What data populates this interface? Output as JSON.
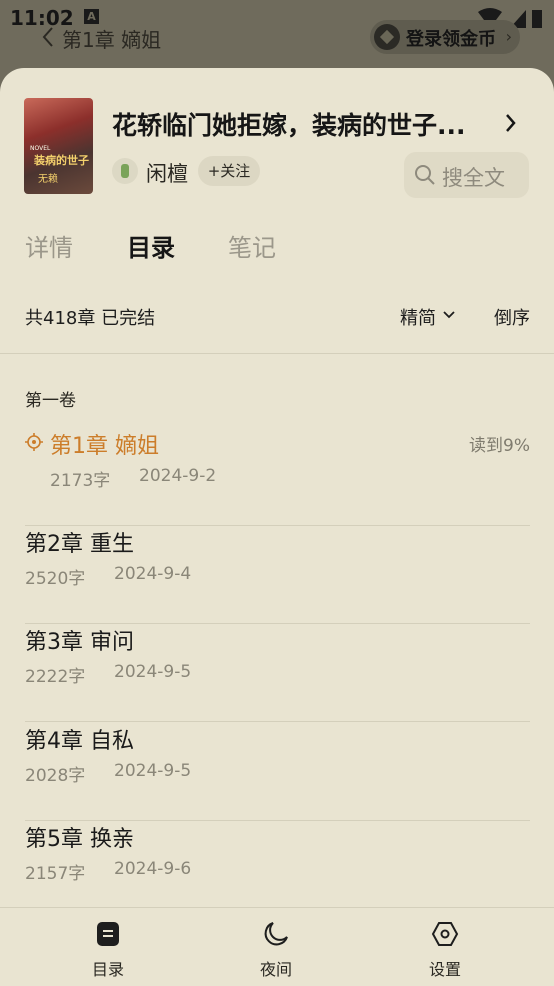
{
  "status_bar": {
    "time": "11:02",
    "indicator": "A"
  },
  "reader_bar": {
    "chapter_title": "第1章 嫡姐",
    "coin_label": "登录领金币"
  },
  "book": {
    "title": "花轿临门她拒嫁，装病的世子...",
    "author": "闲檀",
    "follow_label": "+关注",
    "search_label": "搜全文",
    "cover_text": [
      "装病的世子",
      "无赖"
    ]
  },
  "tabs": [
    {
      "label": "详情"
    },
    {
      "label": "目录"
    },
    {
      "label": "笔记"
    }
  ],
  "catalog": {
    "summary": "共418章 已完结",
    "charset_toggle": "精简",
    "sort_label": "倒序",
    "volume": "第一卷"
  },
  "chapters": [
    {
      "name": "第1章 嫡姐",
      "words": "2173字",
      "date": "2024-9-2",
      "progress": "读到9%"
    },
    {
      "name": "第2章 重生",
      "words": "2520字",
      "date": "2024-9-4"
    },
    {
      "name": "第3章 审问",
      "words": "2222字",
      "date": "2024-9-5"
    },
    {
      "name": "第4章 自私",
      "words": "2028字",
      "date": "2024-9-5"
    },
    {
      "name": "第5章 换亲",
      "words": "2157字",
      "date": "2024-9-6"
    }
  ],
  "bottom_nav": [
    {
      "label": "目录",
      "icon": "catalog-icon"
    },
    {
      "label": "夜间",
      "icon": "moon-icon"
    },
    {
      "label": "设置",
      "icon": "hexagon-settings-icon"
    }
  ],
  "colors": {
    "accent": "#cc7d2a",
    "sheet_bg": "#e9e4d1",
    "dim_bg": "#6f6b5c"
  }
}
